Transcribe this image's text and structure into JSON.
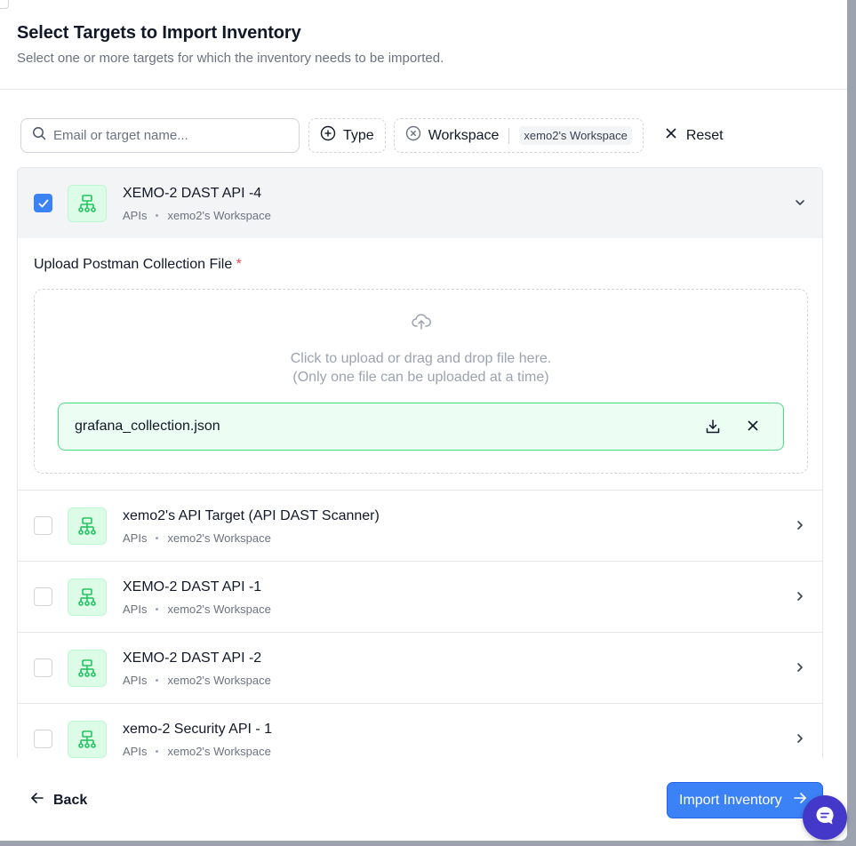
{
  "header": {
    "title": "Select Targets to Import Inventory",
    "subtitle": "Select one or more targets for which the inventory needs to be imported."
  },
  "filters": {
    "search_placeholder": "Email or target name...",
    "type_label": "Type",
    "workspace_label": "Workspace",
    "workspace_value": "xemo2's Workspace",
    "reset_label": "Reset"
  },
  "targets": [
    {
      "name": "XEMO-2 DAST API -4",
      "category": "APIs",
      "workspace": "xemo2's Workspace",
      "checked": true,
      "expanded": true
    },
    {
      "name": "xemo2's API Target (API DAST Scanner)",
      "category": "APIs",
      "workspace": "xemo2's Workspace",
      "checked": false,
      "expanded": false
    },
    {
      "name": "XEMO-2 DAST API -1",
      "category": "APIs",
      "workspace": "xemo2's Workspace",
      "checked": false,
      "expanded": false
    },
    {
      "name": "XEMO-2 DAST API -2",
      "category": "APIs",
      "workspace": "xemo2's Workspace",
      "checked": false,
      "expanded": false
    },
    {
      "name": "xemo-2 Security API - 1",
      "category": "APIs",
      "workspace": "xemo2's Workspace",
      "checked": false,
      "expanded": false
    }
  ],
  "upload": {
    "label": "Upload Postman Collection File",
    "required_mark": "*",
    "hint_line1": "Click to upload or drag and drop file here.",
    "hint_line2": "(Only one file can be uploaded at a time)",
    "file_name": "grafana_collection.json"
  },
  "footer": {
    "back_label": "Back",
    "import_label": "Import Inventory"
  },
  "colors": {
    "primary": "#3b82f6",
    "success_bg": "#ecfdf3",
    "success_border": "#4ade80",
    "icon_green": "#22c55e",
    "chat_bg": "#4338ca"
  }
}
